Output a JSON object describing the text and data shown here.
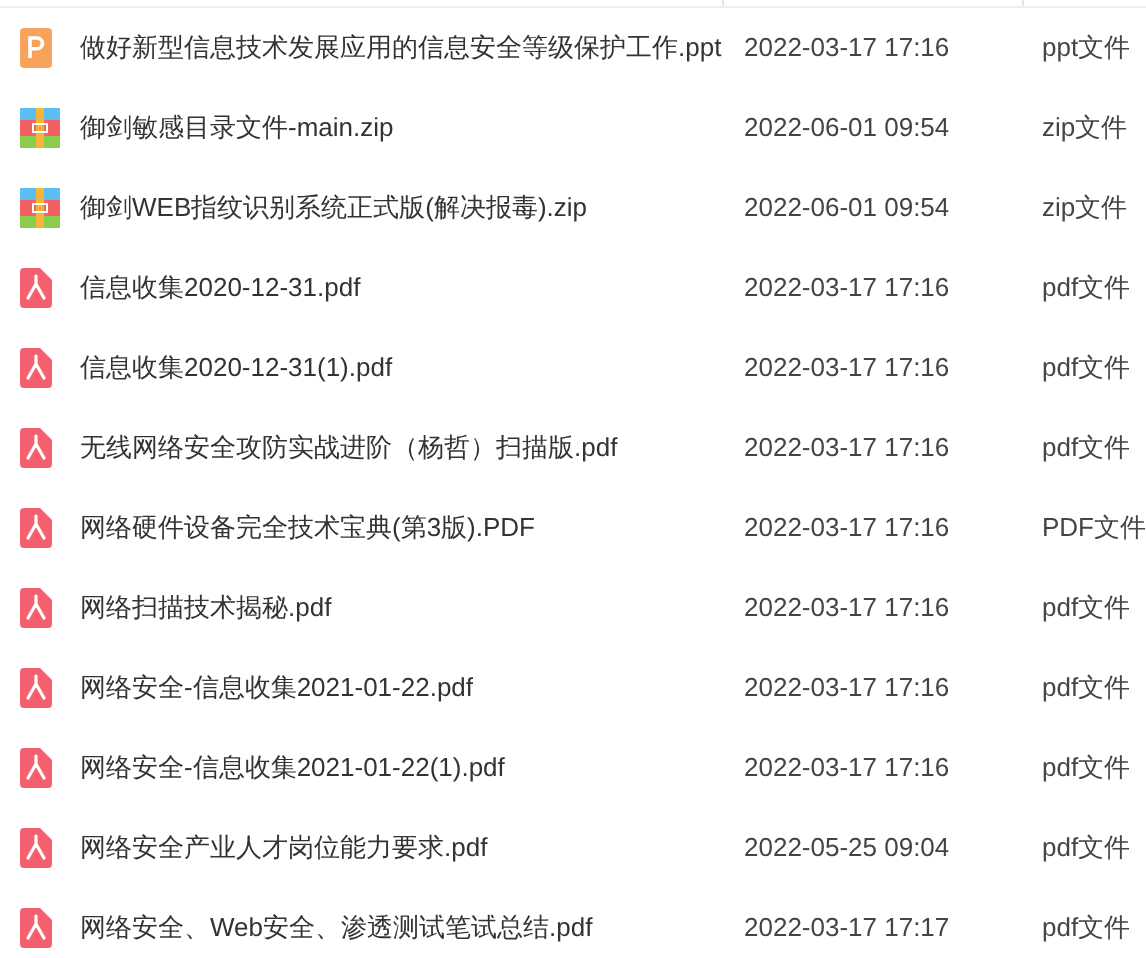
{
  "files": [
    {
      "kind": "ppt",
      "name": "做好新型信息技术发展应用的信息安全等级保护工作.ppt",
      "modified": "2022-03-17 17:16",
      "type": "ppt文件"
    },
    {
      "kind": "zip",
      "name": "御剑敏感目录文件-main.zip",
      "modified": "2022-06-01 09:54",
      "type": "zip文件"
    },
    {
      "kind": "zip",
      "name": "御剑WEB指纹识别系统正式版(解决报毒).zip",
      "modified": "2022-06-01 09:54",
      "type": "zip文件"
    },
    {
      "kind": "pdf",
      "name": "信息收集2020-12-31.pdf",
      "modified": "2022-03-17 17:16",
      "type": "pdf文件"
    },
    {
      "kind": "pdf",
      "name": "信息收集2020-12-31(1).pdf",
      "modified": "2022-03-17 17:16",
      "type": "pdf文件"
    },
    {
      "kind": "pdf",
      "name": "无线网络安全攻防实战进阶（杨哲）扫描版.pdf",
      "modified": "2022-03-17 17:16",
      "type": "pdf文件"
    },
    {
      "kind": "pdf",
      "name": "网络硬件设备完全技术宝典(第3版).PDF",
      "modified": "2022-03-17 17:16",
      "type": "PDF文件"
    },
    {
      "kind": "pdf",
      "name": "网络扫描技术揭秘.pdf",
      "modified": "2022-03-17 17:16",
      "type": "pdf文件"
    },
    {
      "kind": "pdf",
      "name": "网络安全-信息收集2021-01-22.pdf",
      "modified": "2022-03-17 17:16",
      "type": "pdf文件"
    },
    {
      "kind": "pdf",
      "name": "网络安全-信息收集2021-01-22(1).pdf",
      "modified": "2022-03-17 17:16",
      "type": "pdf文件"
    },
    {
      "kind": "pdf",
      "name": "网络安全产业人才岗位能力要求.pdf",
      "modified": "2022-05-25 09:04",
      "type": "pdf文件"
    },
    {
      "kind": "pdf",
      "name": "网络安全、Web安全、渗透测试笔试总结.pdf",
      "modified": "2022-03-17 17:17",
      "type": "pdf文件"
    }
  ]
}
